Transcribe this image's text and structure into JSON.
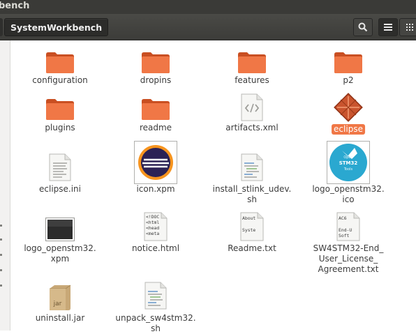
{
  "window": {
    "title": "bench"
  },
  "toolbar": {
    "location": "SystemWorkbench"
  },
  "files": [
    {
      "name": "configuration",
      "type": "folder"
    },
    {
      "name": "dropins",
      "type": "folder"
    },
    {
      "name": "features",
      "type": "folder"
    },
    {
      "name": "p2",
      "type": "folder"
    },
    {
      "name": "plugins",
      "type": "folder"
    },
    {
      "name": "readme",
      "type": "folder"
    },
    {
      "name": "artifacts.xml",
      "type": "xml"
    },
    {
      "name": "eclipse",
      "type": "executable",
      "selected": true
    },
    {
      "name": "eclipse.ini",
      "type": "text"
    },
    {
      "name": "icon.xpm",
      "type": "image-eclipse"
    },
    {
      "name": "install_stlink_udev.\nsh",
      "type": "script"
    },
    {
      "name": "logo_openstm32.\nico",
      "type": "image-openstm"
    },
    {
      "name": "logo_openstm32.\nxpm",
      "type": "image-dark"
    },
    {
      "name": "notice.html",
      "type": "html",
      "preview": [
        "<!DOC",
        "<html",
        "<head",
        "<meta"
      ]
    },
    {
      "name": "Readme.txt",
      "type": "text-preview",
      "preview": [
        "About",
        "",
        "Syste"
      ]
    },
    {
      "name": "SW4STM32-End_\nUser_License_\nAgreement.txt",
      "type": "text-preview",
      "preview": [
        "AC6",
        "",
        "End-U",
        "Soft"
      ]
    },
    {
      "name": "uninstall.jar",
      "type": "jar",
      "badge": "jar"
    },
    {
      "name": "unpack_sw4stm32.\nsh",
      "type": "script"
    }
  ],
  "openstm_logo": {
    "line1": "Open",
    "line2": "STM32",
    "line3": "Tools"
  },
  "colors": {
    "folder": "#f07746",
    "selection": "#f07746",
    "toolbar": "#3c3c39"
  }
}
